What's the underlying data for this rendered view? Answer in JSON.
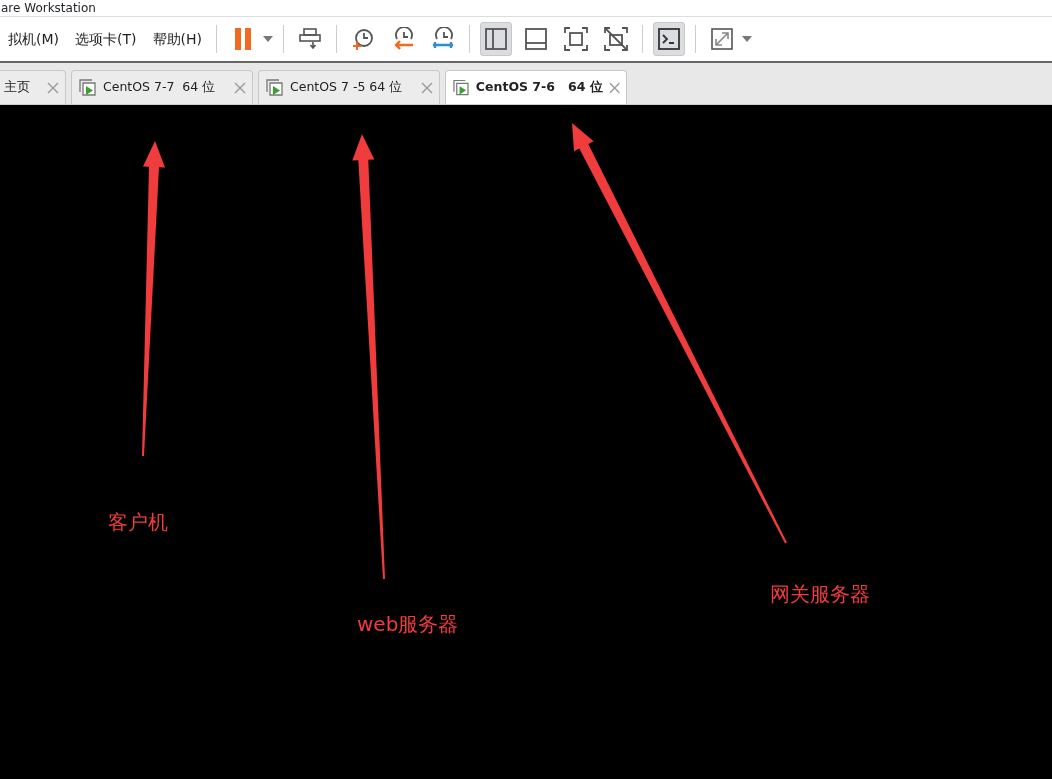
{
  "window": {
    "title": "are Workstation"
  },
  "menu": [
    {
      "label": "拟机(M)"
    },
    {
      "label": "选项卡(T)"
    },
    {
      "label": "帮助(H)"
    }
  ],
  "toolbar": [
    {
      "kind": "pause",
      "selected": false
    },
    {
      "kind": "sep"
    },
    {
      "kind": "sendkeys",
      "selected": false
    },
    {
      "kind": "sep"
    },
    {
      "kind": "snap-take",
      "selected": false
    },
    {
      "kind": "snap-revert",
      "selected": false
    },
    {
      "kind": "snap-manage",
      "selected": false
    },
    {
      "kind": "sep"
    },
    {
      "kind": "view-library",
      "selected": true
    },
    {
      "kind": "view-thumb",
      "selected": false
    },
    {
      "kind": "view-full",
      "selected": false
    },
    {
      "kind": "view-unity",
      "selected": false
    },
    {
      "kind": "sep"
    },
    {
      "kind": "console",
      "selected": true
    },
    {
      "kind": "sep"
    },
    {
      "kind": "stretch",
      "selected": false
    }
  ],
  "tabs": [
    {
      "kind": "home",
      "label": "主页",
      "selected": false
    },
    {
      "kind": "vm",
      "label": "CentOS 7-7  64 位",
      "selected": false
    },
    {
      "kind": "vm",
      "label": "CentOS 7 -5 64 位",
      "selected": false
    },
    {
      "kind": "vm",
      "label": "CentOS 7-6   64 位",
      "selected": true
    }
  ],
  "annotations": [
    {
      "text": "客户机"
    },
    {
      "text": "web服务器"
    },
    {
      "text": "网关服务器"
    }
  ]
}
